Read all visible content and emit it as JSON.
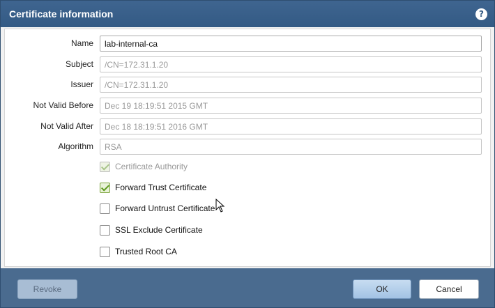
{
  "dialog": {
    "title": "Certificate information",
    "help_icon": "?"
  },
  "fields": [
    {
      "label": "Name",
      "value": "lab-internal-ca"
    },
    {
      "label": "Subject",
      "value": "/CN=172.31.1.20"
    },
    {
      "label": "Issuer",
      "value": "/CN=172.31.1.20"
    },
    {
      "label": "Not Valid Before",
      "value": "Dec 19 18:19:51 2015 GMT"
    },
    {
      "label": "Not Valid After",
      "value": "Dec 18 18:19:51 2016 GMT"
    },
    {
      "label": "Algorithm",
      "value": "RSA"
    }
  ],
  "checkboxes": [
    {
      "label": "Certificate Authority",
      "checked": true,
      "disabled": true
    },
    {
      "label": "Forward Trust Certificate",
      "checked": true,
      "disabled": false
    },
    {
      "label": "Forward Untrust Certificate",
      "checked": false,
      "disabled": false
    },
    {
      "label": "SSL Exclude Certificate",
      "checked": false,
      "disabled": false
    },
    {
      "label": "Trusted Root CA",
      "checked": false,
      "disabled": false
    }
  ],
  "footer": {
    "revoke_label": "Revoke",
    "ok_label": "OK",
    "cancel_label": "Cancel"
  },
  "colors": {
    "titlebar": "#335a84",
    "check_green": "#5e9a1e"
  }
}
